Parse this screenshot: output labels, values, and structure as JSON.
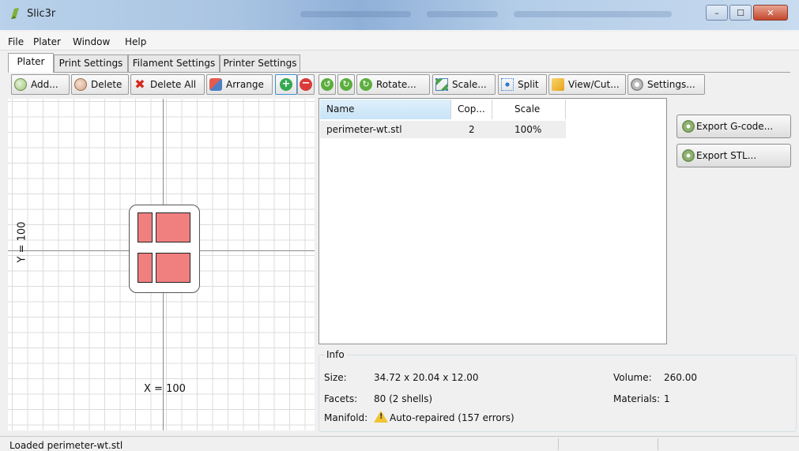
{
  "window": {
    "title": "Slic3r",
    "minimize_glyph": "–",
    "maximize_glyph": "☐",
    "close_glyph": "✕"
  },
  "menu": [
    "File",
    "Plater",
    "Window",
    "Help"
  ],
  "tabs": [
    {
      "label": "Plater",
      "active": true
    },
    {
      "label": "Print Settings",
      "active": false
    },
    {
      "label": "Filament Settings",
      "active": false
    },
    {
      "label": "Printer Settings",
      "active": false
    }
  ],
  "toolbar": {
    "add": "Add...",
    "delete": "Delete",
    "delete_all": "Delete All",
    "arrange": "Arrange",
    "increase_icon": "+",
    "decrease_icon": "−",
    "rotate_left_icon": "↺",
    "rotate_right_icon": "↻",
    "rotate": "Rotate...",
    "scale": "Scale...",
    "split": "Split",
    "view_cut": "View/Cut...",
    "settings": "Settings..."
  },
  "plater": {
    "y_label": "Y = 100",
    "x_label": "X = 100"
  },
  "object_list": {
    "columns": [
      "Name",
      "Cop...",
      "Scale"
    ],
    "rows": [
      {
        "name": "perimeter-wt.stl",
        "copies": "2",
        "scale": "100%"
      }
    ]
  },
  "actions": {
    "export_gcode": "Export G-code...",
    "export_stl": "Export STL..."
  },
  "info": {
    "title": "Info",
    "size_label": "Size:",
    "size_value": "34.72 x 20.04 x 12.00",
    "volume_label": "Volume:",
    "volume_value": "260.00",
    "facets_label": "Facets:",
    "facets_value": "80 (2 shells)",
    "materials_label": "Materials:",
    "materials_value": "1",
    "manifold_label": "Manifold:",
    "manifold_value": "Auto-repaired (157 errors)"
  },
  "status": {
    "text": "Loaded perimeter-wt.stl"
  },
  "colors": {
    "part_fill": "#f08080",
    "selected_header": "#c7e4f7"
  }
}
